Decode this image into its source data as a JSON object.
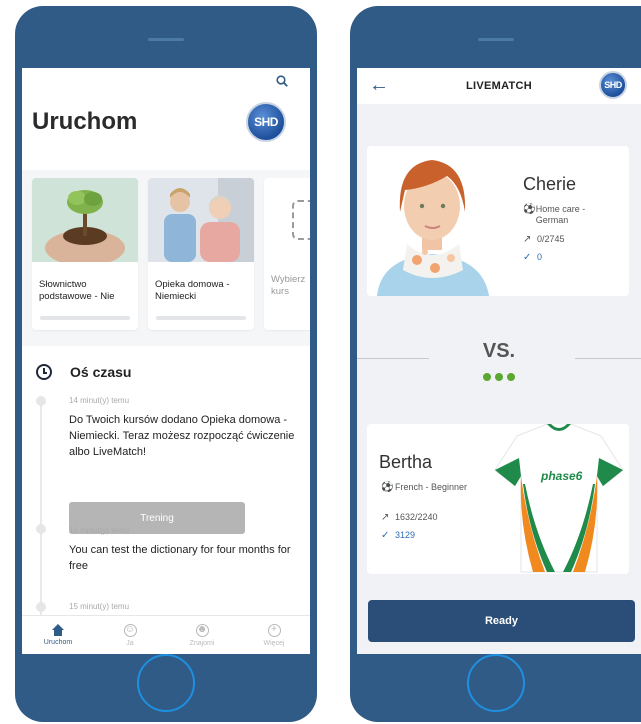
{
  "left_screen": {
    "title": "Uruchom",
    "logo_text": "SHD",
    "courses": [
      {
        "title": "Słownictwo podstawowe - Nie"
      },
      {
        "title": "Opieka domowa - Niemiecki"
      },
      {
        "title": "Wybierz kurs"
      }
    ],
    "timeline": {
      "title": "Oś czasu",
      "entries": [
        {
          "time": "14 minut(y) temu",
          "text": "Do Twoich kursów dodano Opieka domowa - Niemiecki. Teraz możesz rozpocząć ćwiczenie albo LiveMatch!",
          "button": "Trening"
        },
        {
          "time": "14 minut(y) temu",
          "text": "You can test the dictionary for four months for free"
        },
        {
          "time": "15 minut(y) temu"
        }
      ]
    },
    "nav": [
      {
        "label": "Uruchom"
      },
      {
        "label": "Ja"
      },
      {
        "label": "Znajomi"
      },
      {
        "label": "Więcej"
      }
    ]
  },
  "right_screen": {
    "title": "LIVEMATCH",
    "logo_text": "SHD",
    "player1": {
      "name": "Cherie",
      "course": "Home care - German",
      "score": "0/2745",
      "points": "0"
    },
    "vs": "VS.",
    "player2": {
      "name": "Bertha",
      "course": "French - Beginner",
      "score": "1632/2240",
      "points": "3129",
      "jersey_brand": "phase6"
    },
    "ready_label": "Ready"
  },
  "colors": {
    "frame": "#2f5b86",
    "accent": "#2f6db5",
    "green": "#5aa830",
    "button_dark": "#2a4e77"
  }
}
